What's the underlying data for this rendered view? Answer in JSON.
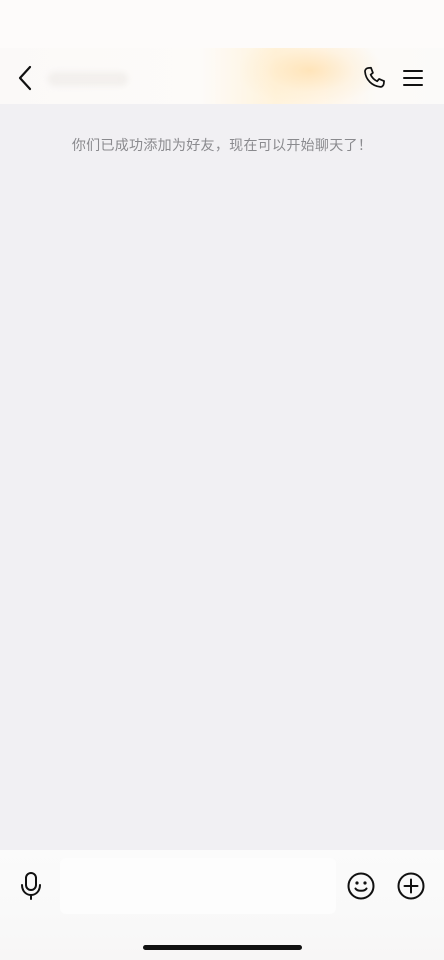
{
  "header": {
    "back_icon": "chevron-left-icon",
    "call_icon": "phone-icon",
    "menu_icon": "hamburger-menu-icon"
  },
  "chat": {
    "system_message": "你们已成功添加为好友，现在可以开始聊天了！"
  },
  "composer": {
    "voice_icon": "microphone-icon",
    "emoji_icon": "smiley-icon",
    "more_icon": "plus-circle-icon",
    "input_value": ""
  },
  "colors": {
    "chat_background": "#f1f0f3",
    "icon_color": "#111111",
    "system_text": "#8a8a8e",
    "header_glow": "#ffd696"
  }
}
